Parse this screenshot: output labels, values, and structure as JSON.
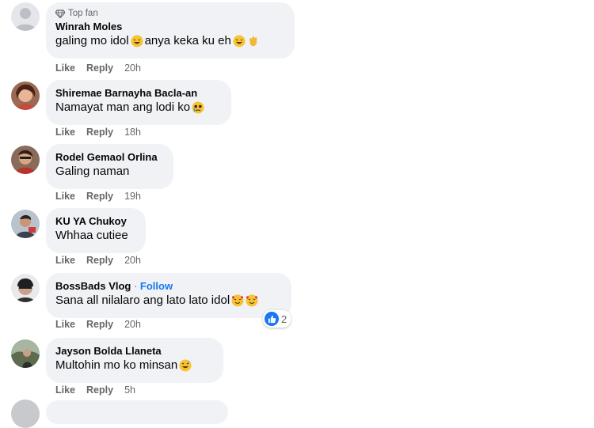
{
  "colors": {
    "accent": "#1877f2",
    "bubble": "#f0f2f5",
    "muted": "#65676b"
  },
  "comments": [
    {
      "author": "Winrah Moles",
      "badge": "Top fan",
      "text_a": "galing mo idol",
      "text_b": " anya keka ku eh",
      "like": "Like",
      "reply": "Reply",
      "time": "20h"
    },
    {
      "author": "Shiremae Barnayha Bacla-an",
      "text": "Namayat man ang lodi ko",
      "like": "Like",
      "reply": "Reply",
      "time": "18h"
    },
    {
      "author": "Rodel Gemaol Orlina",
      "text": "Galing naman",
      "like": "Like",
      "reply": "Reply",
      "time": "19h"
    },
    {
      "author": "KU YA Chukoy",
      "text": "Whhaa cutiee",
      "like": "Like",
      "reply": "Reply",
      "time": "20h"
    },
    {
      "author": "BossBads Vlog",
      "dot": " · ",
      "follow": "Follow",
      "text": "Sana all nilalaro ang lato lato idol",
      "like": "Like",
      "reply": "Reply",
      "time": "20h",
      "reactions": "2"
    },
    {
      "author": "Jayson Bolda Llaneta",
      "text": "Multohin mo ko minsan",
      "like": "Like",
      "reply": "Reply",
      "time": "5h"
    }
  ]
}
